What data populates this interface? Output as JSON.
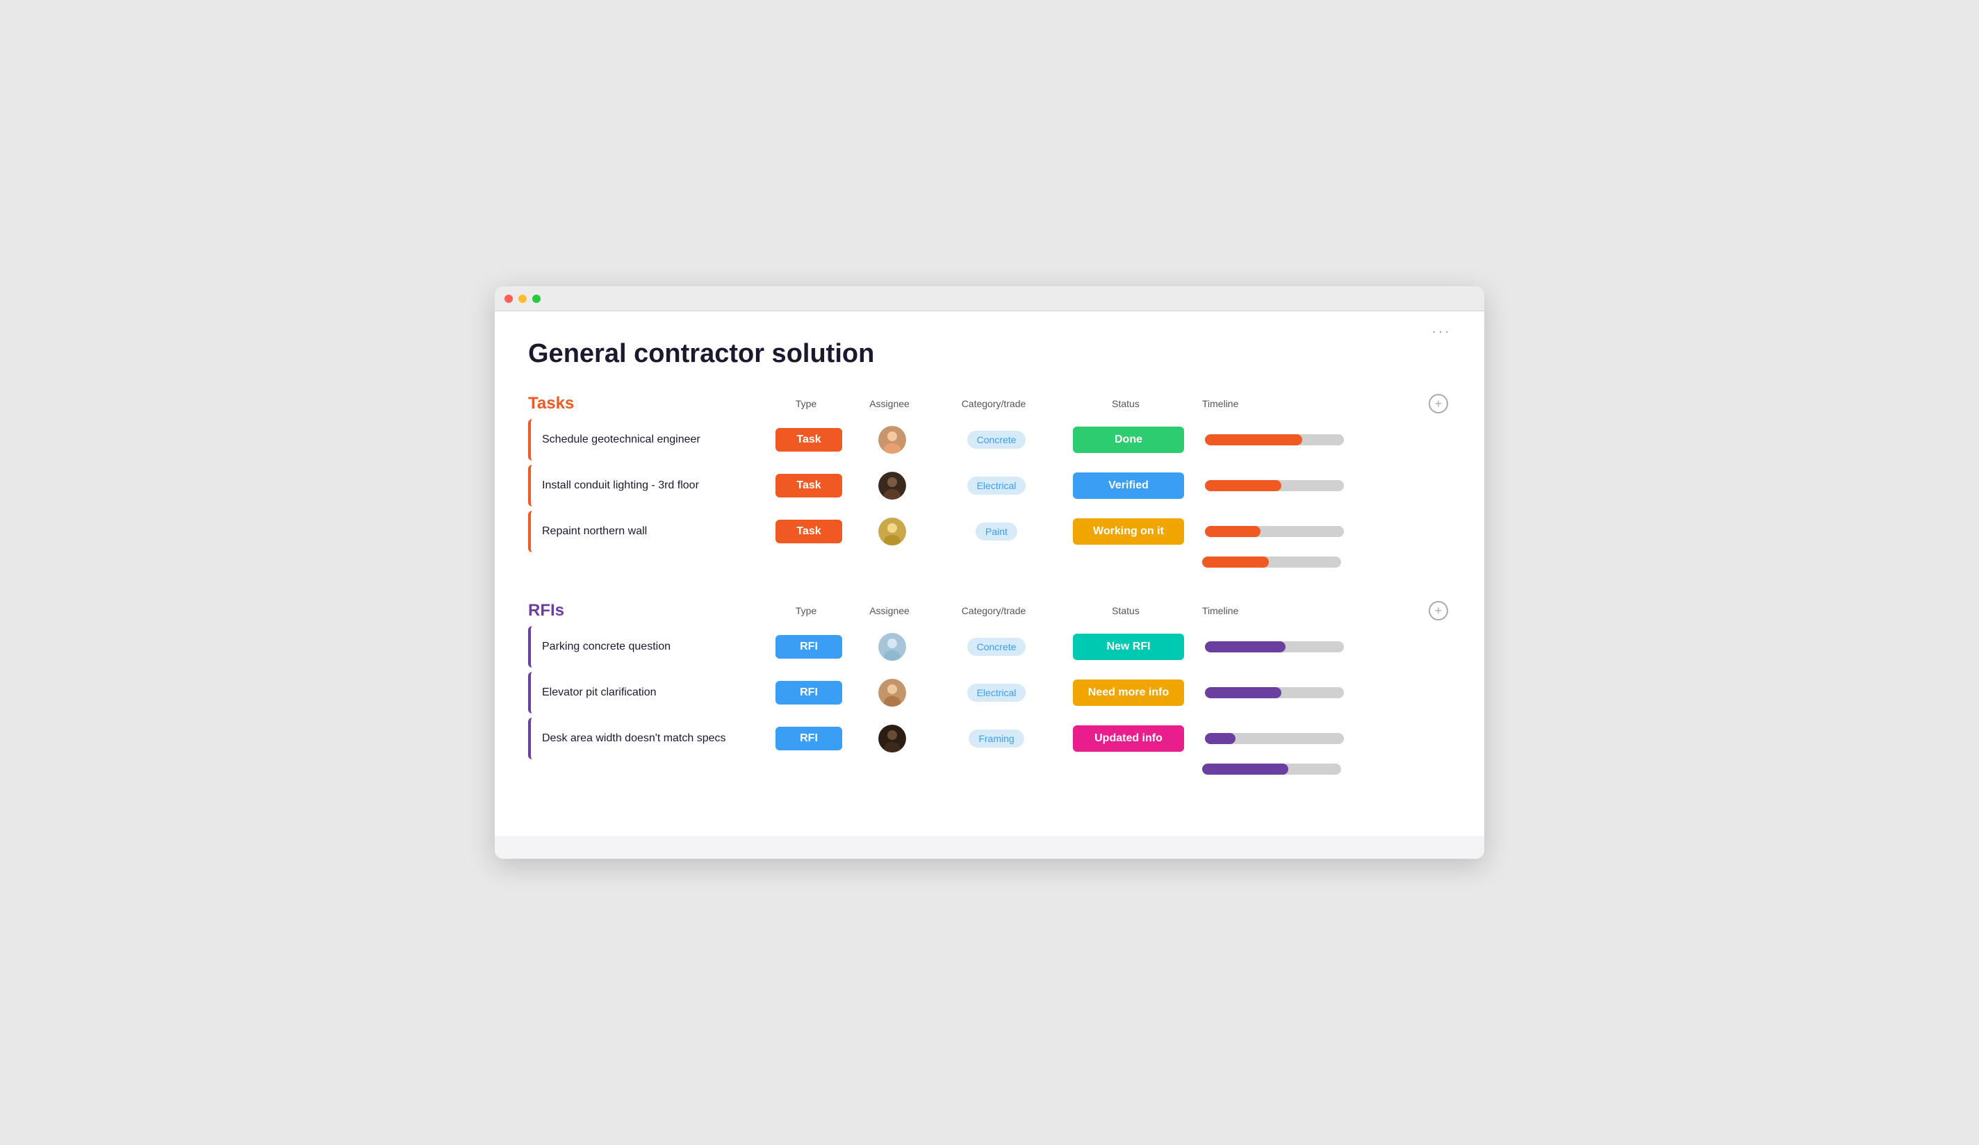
{
  "window": {
    "title": "General contractor solution"
  },
  "header": {
    "title": "General contractor solution",
    "more_icon": "···"
  },
  "tasks_section": {
    "title": "Tasks",
    "columns": [
      "",
      "Type",
      "Assignee",
      "Category/trade",
      "Status",
      "Timeline"
    ],
    "add_button": "+",
    "rows": [
      {
        "name": "Schedule geotechnical engineer",
        "type": "Task",
        "assignee": "person1",
        "category": "Concrete",
        "status": "Done",
        "status_class": "status-done",
        "timeline_pct": 70
      },
      {
        "name": "Install conduit lighting - 3rd floor",
        "type": "Task",
        "assignee": "person2",
        "category": "Electrical",
        "status": "Verified",
        "status_class": "status-verified",
        "timeline_pct": 55
      },
      {
        "name": "Repaint northern wall",
        "type": "Task",
        "assignee": "person3",
        "category": "Paint",
        "status": "Working on it",
        "status_class": "status-working",
        "timeline_pct": 40
      }
    ],
    "extra_timeline_pct": 48
  },
  "rfis_section": {
    "title": "RFIs",
    "columns": [
      "",
      "Type",
      "Assignee",
      "Category/trade",
      "Status",
      "Timeline"
    ],
    "add_button": "+",
    "rows": [
      {
        "name": "Parking concrete question",
        "type": "RFI",
        "assignee": "person4",
        "category": "Concrete",
        "status": "New RFI",
        "status_class": "status-new-rfi",
        "timeline_pct": 58
      },
      {
        "name": "Elevator pit clarification",
        "type": "RFI",
        "assignee": "person5",
        "category": "Electrical",
        "status": "Need more info",
        "status_class": "status-need-more",
        "timeline_pct": 55
      },
      {
        "name": "Desk area width doesn't match specs",
        "type": "RFI",
        "assignee": "person6",
        "category": "Framing",
        "status": "Updated info",
        "status_class": "status-updated",
        "timeline_pct": 22
      }
    ],
    "extra_timeline_pct": 62
  }
}
